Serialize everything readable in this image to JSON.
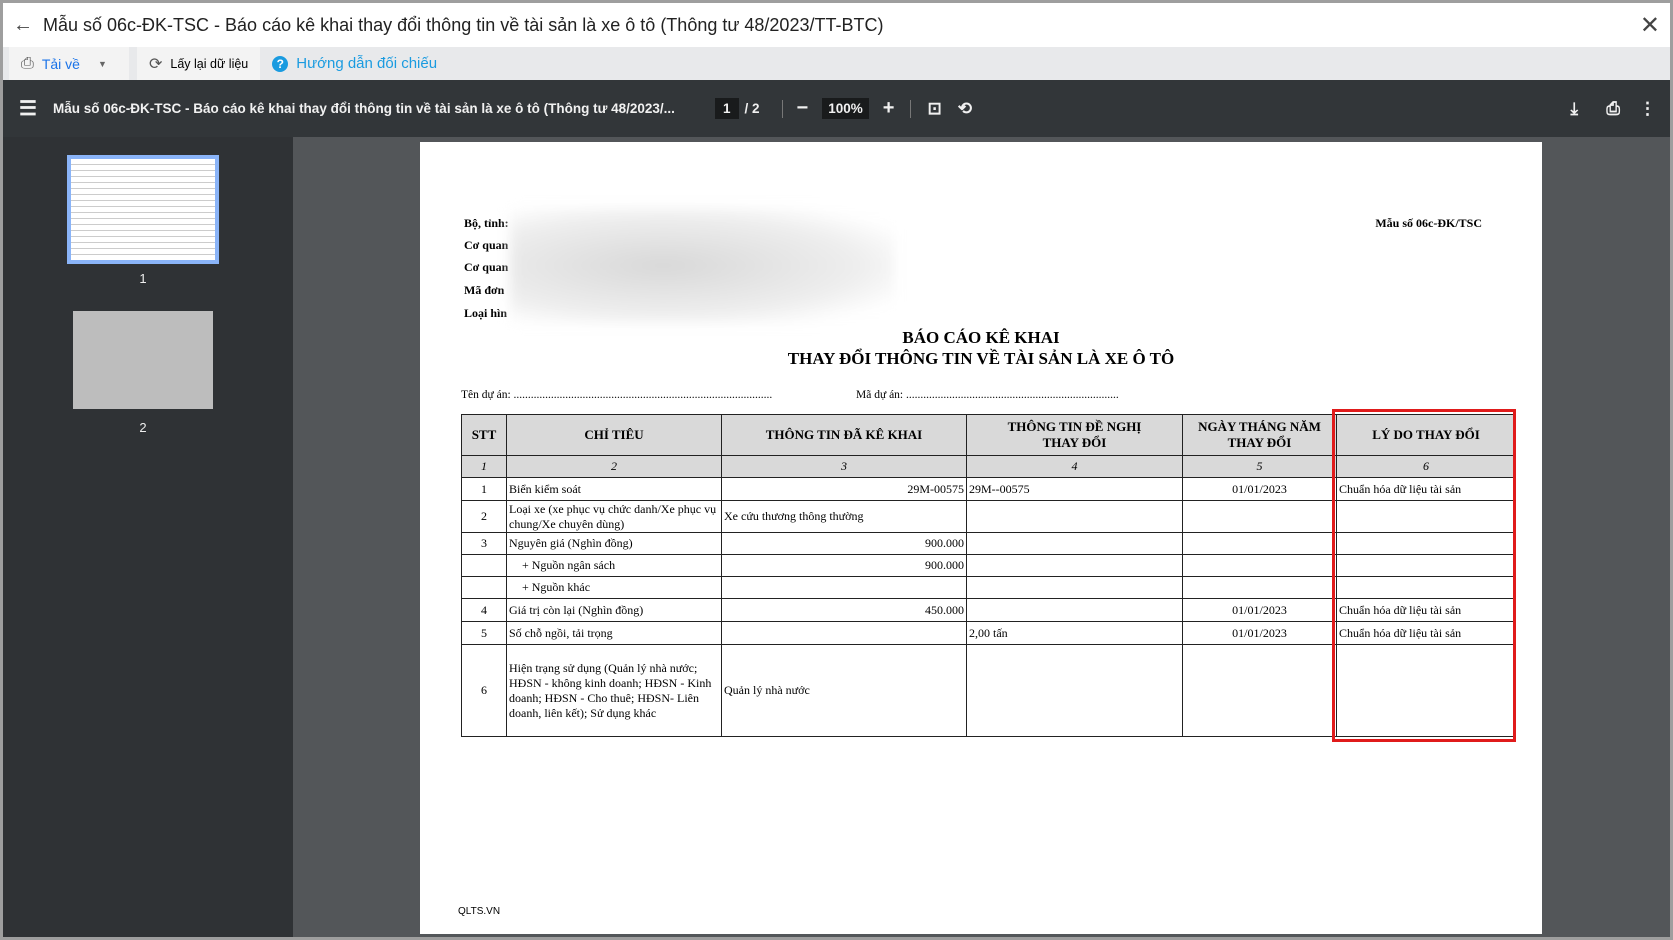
{
  "window": {
    "title": "Mẫu số 06c-ĐK-TSC - Báo cáo kê khai thay đổi thông tin về tài sản là xe ô tô (Thông tư 48/2023/TT-BTC)"
  },
  "toolbar": {
    "download": "Tải về",
    "reload": "Lấy lại dữ liệu",
    "guide": "Hướng dẫn đối chiếu"
  },
  "viewer": {
    "doc_title": "Mẫu số 06c-ĐK-TSC - Báo cáo kê khai thay đổi thông tin về tài sản là xe ô tô (Thông tư 48/2023/...",
    "page": "1",
    "total": "/ 2",
    "zoom": "100%",
    "thumbs": [
      "1",
      "2"
    ]
  },
  "doc": {
    "header_lines": [
      "Bộ, tỉnh:",
      "Cơ quan",
      "Cơ quan",
      "Mã đơn",
      "Loại hìn"
    ],
    "form_no": "Mẫu số 06c-ĐK/TSC",
    "title1": "BÁO CÁO KÊ KHAI",
    "title2": "THAY ĐỔI THÔNG TIN VỀ TÀI SẢN LÀ XE Ô TÔ",
    "project": "Tên dự án: ..........................................................................................",
    "project_code": "Mã dự án: ..........................................................................",
    "columns": [
      "STT",
      "CHỈ TIÊU",
      "THÔNG TIN ĐÃ KÊ KHAI",
      "THÔNG TIN ĐỀ NGHỊ THAY ĐỔI",
      "NGÀY THÁNG NĂM THAY ĐỔI",
      "LÝ DO THAY ĐỔI"
    ],
    "col_index": [
      "1",
      "2",
      "3",
      "4",
      "5",
      "6"
    ],
    "rows": [
      [
        "1",
        "Biển kiểm soát",
        "29M-00575",
        "29M--00575",
        "01/01/2023",
        "Chuẩn hóa dữ liệu tài sản"
      ],
      [
        "2",
        "Loại xe (xe phục vụ chức danh/Xe phục vụ chung/Xe chuyên dùng)",
        "Xe cứu thương thông thường",
        "",
        "",
        ""
      ],
      [
        "3",
        "Nguyên giá (Nghìn đồng)",
        "900.000",
        "",
        "",
        ""
      ],
      [
        "",
        "+ Nguồn ngân sách",
        "900.000",
        "",
        "",
        ""
      ],
      [
        "",
        "+ Nguồn khác",
        "",
        "",
        "",
        ""
      ],
      [
        "4",
        "Giá trị còn lại (Nghìn đồng)",
        "450.000",
        "",
        "01/01/2023",
        "Chuẩn hóa dữ liệu tài sản"
      ],
      [
        "5",
        "Số chỗ ngồi, tải trọng",
        "",
        "2,00 tấn",
        "01/01/2023",
        "Chuẩn hóa dữ liệu tài sản"
      ],
      [
        "6",
        "Hiện trạng sử dụng (Quản lý nhà nước; HĐSN - không kinh doanh; HĐSN - Kinh doanh; HĐSN - Cho thuê; HĐSN- Liên doanh, liên kết); Sử dụng khác",
        "Quản lý nhà nước",
        "",
        "",
        ""
      ]
    ],
    "footer": "QLTS.VN"
  }
}
